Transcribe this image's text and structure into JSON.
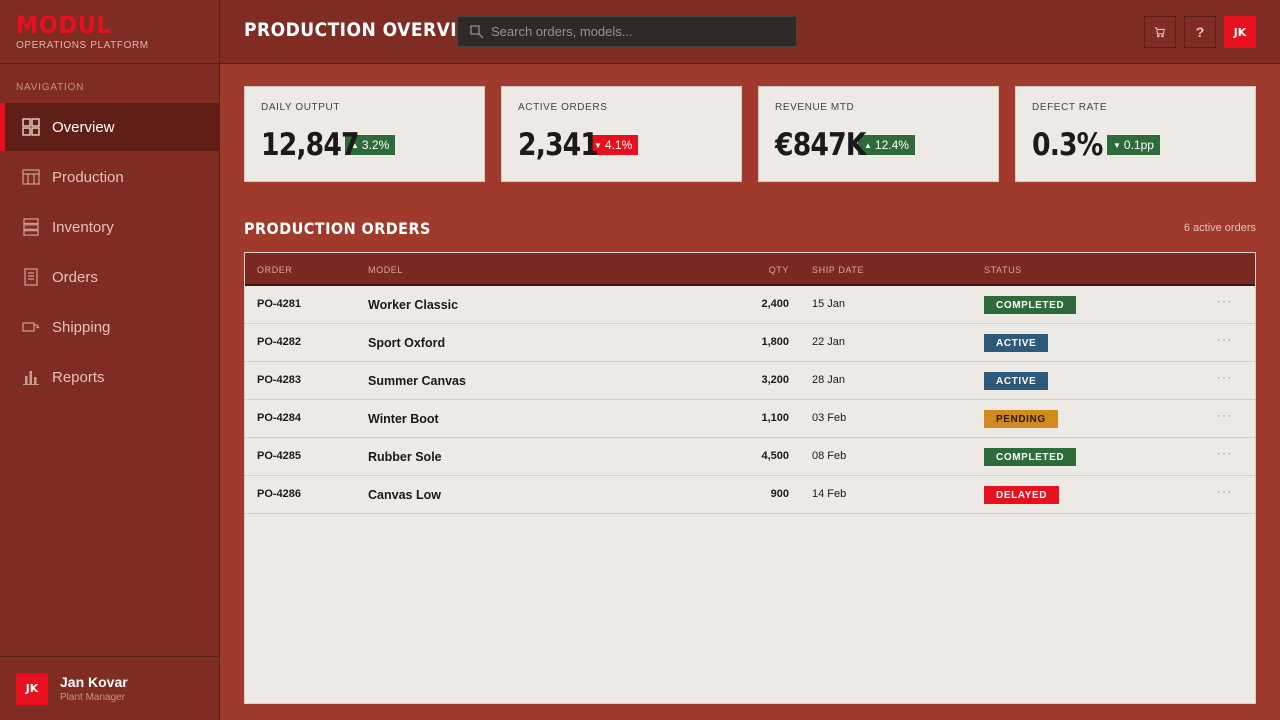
{
  "brand": {
    "logo": "MODUL",
    "subtitle": "OPERATIONS PLATFORM"
  },
  "colors": {
    "accent": "#e8101e",
    "sidebar": "#7f2c22",
    "background": "#a03a2c",
    "card": "#ede9e4",
    "up": "#2e6b3a",
    "down": "#e8101e",
    "completed": "#2e6b3a",
    "active": "#2d5a7b",
    "pending": "#d08a1e",
    "delayed": "#e8101e"
  },
  "sidebar": {
    "heading": "NAVIGATION",
    "items": [
      {
        "label": "Overview",
        "icon": "grid-icon",
        "active": true
      },
      {
        "label": "Production",
        "icon": "factory-icon",
        "active": false
      },
      {
        "label": "Inventory",
        "icon": "stack-icon",
        "active": false
      },
      {
        "label": "Orders",
        "icon": "document-icon",
        "active": false
      },
      {
        "label": "Shipping",
        "icon": "truck-icon",
        "active": false
      },
      {
        "label": "Reports",
        "icon": "bar-chart-icon",
        "active": false
      }
    ],
    "user": {
      "initials": "JK",
      "name": "Jan Kovar",
      "role": "Plant Manager"
    }
  },
  "header": {
    "title": "PRODUCTION OVERVIEW",
    "search_placeholder": "Search orders, models...",
    "buttons": [
      {
        "icon": "cart-icon",
        "label": ""
      },
      {
        "icon": "help-icon",
        "label": "?"
      }
    ],
    "avatar_initials": "JK"
  },
  "kpis": [
    {
      "label": "DAILY OUTPUT",
      "value": "12,847",
      "change": "3.2%",
      "direction": "up"
    },
    {
      "label": "ACTIVE ORDERS",
      "value": "2,341",
      "change": "4.1%",
      "direction": "down"
    },
    {
      "label": "REVENUE MTD",
      "value": "€847K",
      "change": "12.4%",
      "direction": "up"
    },
    {
      "label": "DEFECT RATE",
      "value": "0.3%",
      "change": "0.1pp",
      "direction": "down-good"
    }
  ],
  "orders": {
    "title": "PRODUCTION ORDERS",
    "count_text": "6 active orders",
    "columns": [
      "ORDER",
      "MODEL",
      "QTY",
      "SHIP DATE",
      "STATUS"
    ],
    "rows": [
      {
        "order": "PO-4281",
        "model": "Worker Classic",
        "qty": "2,400",
        "date": "15 Jan",
        "status": "COMPLETED"
      },
      {
        "order": "PO-4282",
        "model": "Sport Oxford",
        "qty": "1,800",
        "date": "22 Jan",
        "status": "ACTIVE"
      },
      {
        "order": "PO-4283",
        "model": "Summer Canvas",
        "qty": "3,200",
        "date": "28 Jan",
        "status": "ACTIVE"
      },
      {
        "order": "PO-4284",
        "model": "Winter Boot",
        "qty": "1,100",
        "date": "03 Feb",
        "status": "PENDING"
      },
      {
        "order": "PO-4285",
        "model": "Rubber Sole",
        "qty": "4,500",
        "date": "08 Feb",
        "status": "COMPLETED"
      },
      {
        "order": "PO-4286",
        "model": "Canvas Low",
        "qty": "900",
        "date": "14 Feb",
        "status": "DELAYED"
      }
    ],
    "row_menu": "···"
  }
}
